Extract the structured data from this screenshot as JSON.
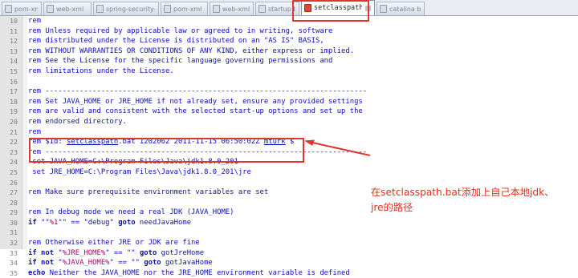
{
  "tabs": [
    {
      "label": "pom-xml"
    },
    {
      "label": "web-xml"
    },
    {
      "label": "spring-security-xml"
    },
    {
      "label": "pom-xml"
    },
    {
      "label": "web-xml"
    },
    {
      "label": "startup bat"
    },
    {
      "label": "setclasspath.bat",
      "active": true
    },
    {
      "label": "catalina bat"
    }
  ],
  "code_lines": [
    {
      "n": "10",
      "t": "rem"
    },
    {
      "n": "11",
      "t": "rem Unless required by applicable law or agreed to in writing, software"
    },
    {
      "n": "12",
      "t": "rem distributed under the License is distributed on an \"AS IS\" BASIS,"
    },
    {
      "n": "13",
      "t": "rem WITHOUT WARRANTIES OR CONDITIONS OF ANY KIND, either express or implied."
    },
    {
      "n": "14",
      "t": "rem See the License for the specific language governing permissions and"
    },
    {
      "n": "15",
      "t": "rem limitations under the License."
    },
    {
      "n": "16",
      "t": ""
    },
    {
      "n": "17",
      "t": "rem ---------------------------------------------------------------------------"
    },
    {
      "n": "18",
      "t": "rem Set JAVA_HOME or JRE_HOME if not already set, ensure any provided settings"
    },
    {
      "n": "19",
      "t": "rem are valid and consistent with the selected start-up options and set up the"
    },
    {
      "n": "20",
      "t": "rem endorsed directory."
    },
    {
      "n": "21",
      "t": "rem"
    },
    {
      "n": "22",
      "pre": "rem $Id: ",
      "u": "setclasspath",
      "mid": ".bat 1202062 2011-11-15 06:50:02Z ",
      "u2": "mturk",
      "post": " $"
    },
    {
      "n": "23",
      "t": "rem ---------------------------------------------------------------------------"
    },
    {
      "n": "24",
      "t": " set JAVA_HOME=C:\\Program Files\\Java\\jdk1.8.0_201"
    },
    {
      "n": "25",
      "t": " set JRE_HOME=C:\\Program Files\\Java\\jdk1.8.0_201\\jre"
    },
    {
      "n": "26",
      "t": ""
    },
    {
      "n": "27",
      "t": "rem Make sure prerequisite environment variables are set"
    },
    {
      "n": "28",
      "t": ""
    },
    {
      "n": "29",
      "t": "rem In debug mode we need a real JDK (JAVA_HOME)"
    },
    {
      "n": "30",
      "k": "if",
      "a": " \"\"",
      "s": "%1",
      "b": "\"\" == \"debug\" ",
      "k2": "goto",
      "c": " needJavaHome"
    },
    {
      "n": "31",
      "t": ""
    },
    {
      "n": "32",
      "t": "rem Otherwise either JRE or JDK are fine"
    },
    {
      "n": "33",
      "k": "if not",
      "a": " \"",
      "s": "%JRE_HOME%",
      "b": "\" == \"\" ",
      "k2": "goto",
      "c": " gotJreHome"
    },
    {
      "n": "34",
      "k": "if not",
      "a": " \"",
      "s": "%JAVA_HOME%",
      "b": "\" == \"\" ",
      "k2": "goto",
      "c": " gotJavaHome"
    },
    {
      "n": "35",
      "k": "echo",
      "c": " Neither the JAVA_HOME nor the JRE_HOME environment variable is defined"
    }
  ],
  "annotation_lines": [
    "在setclasspath.bat添加上自己本地jdk、",
    "jre的路径"
  ],
  "colors": {
    "highlight": "#e0362b",
    "annotation": "#ea2b1e",
    "code": "#0b0fb8"
  }
}
